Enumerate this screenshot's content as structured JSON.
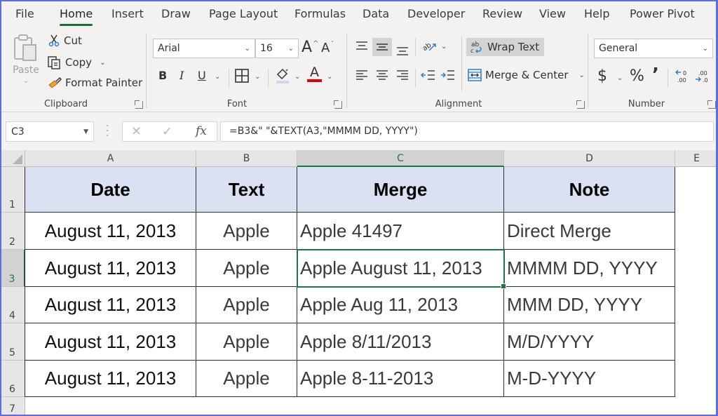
{
  "ribbon_tabs": [
    {
      "label": "File",
      "active": false
    },
    {
      "label": "Home",
      "active": true
    },
    {
      "label": "Insert",
      "active": false
    },
    {
      "label": "Draw",
      "active": false
    },
    {
      "label": "Page Layout",
      "active": false
    },
    {
      "label": "Formulas",
      "active": false
    },
    {
      "label": "Data",
      "active": false
    },
    {
      "label": "Developer",
      "active": false
    },
    {
      "label": "Review",
      "active": false
    },
    {
      "label": "View",
      "active": false
    },
    {
      "label": "Help",
      "active": false
    },
    {
      "label": "Power Pivot",
      "active": false
    }
  ],
  "clipboard": {
    "label": "Clipboard",
    "paste": "Paste",
    "cut": "Cut",
    "copy": "Copy",
    "format_painter": "Format Painter"
  },
  "font": {
    "label": "Font",
    "font_name": "Arial",
    "font_size": "16",
    "bold": "B",
    "italic": "I",
    "underline": "U",
    "font_color": "#e00000",
    "increase_size": "A",
    "decrease_size": "A",
    "color_letter": "A"
  },
  "alignment": {
    "label": "Alignment",
    "wrap_text": "Wrap Text",
    "merge_center": "Merge & Center"
  },
  "number": {
    "label": "Number",
    "format": "General",
    "currency": "$",
    "percent": "%",
    "comma": "’"
  },
  "formula_bar": {
    "name_box": "C3",
    "fx": "fx",
    "formula": "=B3&\" \"&TEXT(A3,\"MMMM DD, YYYY\")"
  },
  "sheet": {
    "columns": [
      "A",
      "B",
      "C",
      "D",
      "E"
    ],
    "selected_column": "C",
    "rows": [
      "1",
      "2",
      "3",
      "4",
      "5",
      "6",
      "7"
    ],
    "selected_row": "3",
    "selected_cell": "C3",
    "header_fill": "#d9e1f2",
    "accent": "#217346",
    "table_headers": [
      "Date",
      "Text",
      "Merge",
      "Note"
    ],
    "table_rows": [
      [
        "August 11, 2013",
        "Apple",
        "Apple 41497",
        "Direct Merge"
      ],
      [
        "August 11, 2013",
        "Apple",
        "Apple August 11, 2013",
        "MMMM DD, YYYY"
      ],
      [
        "August 11, 2013",
        "Apple",
        "Apple Aug 11, 2013",
        "MMM DD, YYYY"
      ],
      [
        "August 11, 2013",
        "Apple",
        "Apple 8/11/2013",
        "M/D/YYYY"
      ],
      [
        "August 11, 2013",
        "Apple",
        "Apple 8-11-2013",
        "M-D-YYYY"
      ]
    ]
  }
}
